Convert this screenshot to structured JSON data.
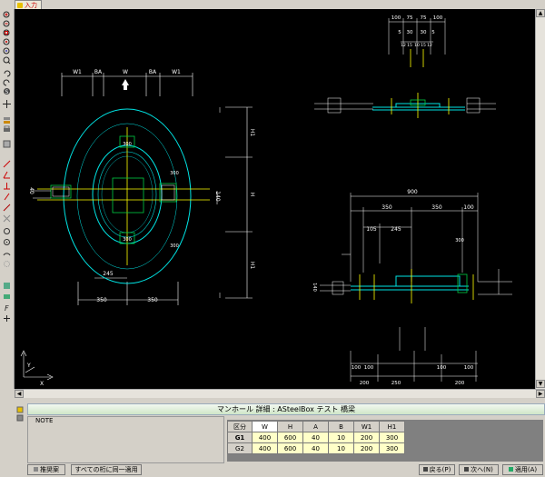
{
  "tab": {
    "label": "入力"
  },
  "panel": {
    "title": "マンホール 詳細 : ASteelBox テスト 橋梁",
    "note_label": "NOTE",
    "table": {
      "headers": [
        "区分",
        "W",
        "H",
        "A",
        "B",
        "W1",
        "H1"
      ],
      "rows": [
        {
          "label": "G1",
          "values": [
            "400",
            "600",
            "40",
            "10",
            "200",
            "300"
          ]
        },
        {
          "label": "G2",
          "values": [
            "400",
            "600",
            "40",
            "10",
            "200",
            "300"
          ]
        }
      ]
    }
  },
  "buttons": {
    "recommend": "推奨案",
    "apply_all": "すべての桁に同一適用",
    "back": "戻る(P)",
    "next": "次へ(N)",
    "apply": "適用(A)"
  },
  "drawing": {
    "main_view": {
      "top_dims": [
        "W1",
        "BA",
        "W",
        "BA",
        "W1"
      ],
      "right_dims": [
        "H1",
        "H",
        "H1"
      ],
      "bottom_dims": [
        "245",
        "350",
        "350"
      ],
      "left_dim": "40",
      "right_dim": "140",
      "small_labels": [
        "300",
        "300",
        "300",
        "300"
      ]
    },
    "top_right_view": {
      "top_dims": [
        "100",
        "75",
        "75",
        "100"
      ],
      "mid_dims": [
        "5",
        "30",
        "30",
        "5"
      ],
      "small_dims": [
        "12",
        "15",
        "10",
        "15",
        "12"
      ]
    },
    "right_view": {
      "top_dim": "900",
      "dims_row1": [
        "350",
        "350",
        "100"
      ],
      "dims_row2": [
        "105",
        "245"
      ],
      "small_label": "300",
      "left_label": "140",
      "bottom_dims_row1": [
        "100",
        "100",
        "100",
        "100"
      ],
      "bottom_dims_row2": [
        "200",
        "250",
        "200"
      ]
    },
    "axes": {
      "x": "X",
      "y": "Y"
    },
    "colors": {
      "cyan": "#00e5e5",
      "yellow": "#ffff00",
      "white": "#ffffff",
      "green": "#00cc44",
      "magenta": "#ff44ff"
    }
  }
}
